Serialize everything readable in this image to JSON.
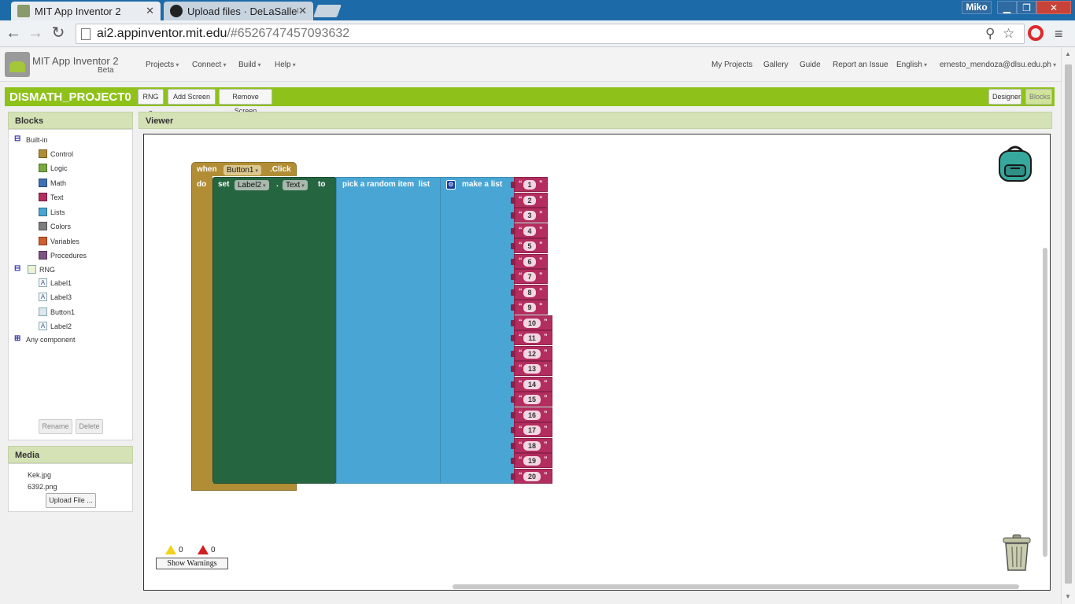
{
  "browser": {
    "tabs": [
      {
        "title": "MIT App Inventor 2",
        "active": true
      },
      {
        "title": "Upload files · DeLaSalleUn",
        "active": false
      }
    ],
    "user": "Miko",
    "url_host": "ai2.appinventor.mit.edu",
    "url_path": "/#6526747457093632"
  },
  "app": {
    "title": "MIT App Inventor 2",
    "beta": "Beta",
    "menu": [
      "Projects",
      "Connect",
      "Build",
      "Help"
    ],
    "right_links": [
      "My Projects",
      "Gallery",
      "Guide",
      "Report an Issue",
      "English",
      "ernesto_mendoza@dlsu.edu.ph"
    ]
  },
  "project": {
    "name": "DISMATH_PROJECT0",
    "screen_select": "RNG",
    "add_screen": "Add Screen ...",
    "remove_screen": "Remove Screen",
    "designer": "Designer",
    "blocks": "Blocks"
  },
  "blocks_panel": {
    "title": "Blocks",
    "builtin_label": "Built-in",
    "builtin": [
      {
        "label": "Control",
        "color": "#b18e35"
      },
      {
        "label": "Logic",
        "color": "#77ab41"
      },
      {
        "label": "Math",
        "color": "#3f71b5"
      },
      {
        "label": "Text",
        "color": "#b32d5e"
      },
      {
        "label": "Lists",
        "color": "#49a6d4"
      },
      {
        "label": "Colors",
        "color": "#7d7d7d"
      },
      {
        "label": "Variables",
        "color": "#d05f2d"
      },
      {
        "label": "Procedures",
        "color": "#7c5385"
      }
    ],
    "screen": "RNG",
    "components": [
      "Label1",
      "Label3",
      "Button1",
      "Label2"
    ],
    "any_component": "Any component",
    "rename": "Rename",
    "delete": "Delete"
  },
  "media": {
    "title": "Media",
    "files": [
      "Kek.jpg",
      "6392.png"
    ],
    "upload": "Upload File ..."
  },
  "viewer": {
    "title": "Viewer",
    "event": {
      "when": "when",
      "component": "Button1",
      "event": ".Click",
      "do": "do"
    },
    "setter": {
      "set": "set",
      "component": "Label2",
      "dot": ".",
      "property": "Text",
      "to": "to"
    },
    "pick": "pick a random item  list",
    "make": "make a list",
    "items": [
      "1",
      "2",
      "3",
      "4",
      "5",
      "6",
      "7",
      "8",
      "9",
      "10",
      "11",
      "12",
      "13",
      "14",
      "15",
      "16",
      "17",
      "18",
      "19",
      "20"
    ],
    "warnings_count": "0",
    "errors_count": "0",
    "show_warnings": "Show Warnings"
  },
  "colors": {
    "control": "#b18e35",
    "components": "#256641",
    "lists": "#49a6d4",
    "text": "#b32d5e",
    "app_green": "#8ec21a"
  }
}
